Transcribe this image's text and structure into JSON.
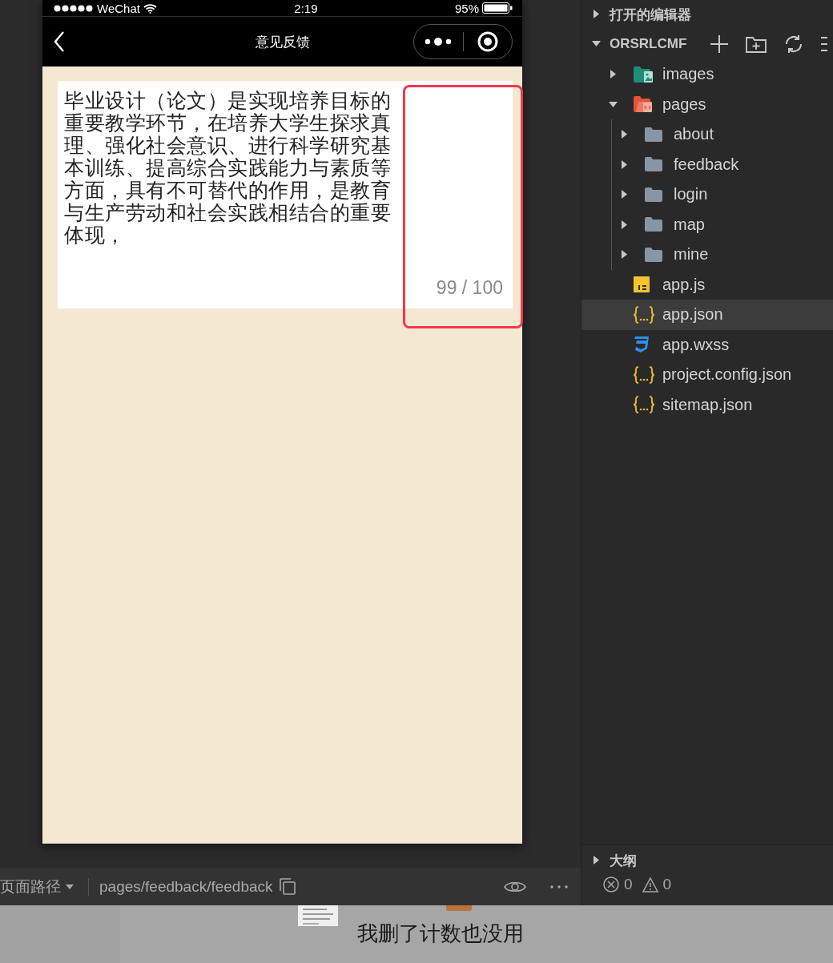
{
  "phone": {
    "status_bar": {
      "carrier": "WeChat",
      "time": "2:19",
      "battery": "95%"
    },
    "nav": {
      "title": "意见反馈"
    },
    "feedback_field": {
      "value": "毕业设计（论文）是实现培养目标的重要教学环节，在培养大学生探求真理、强化社会意识、进行科学研究基本训练、提高综合实践能力与素质等方面，具有不可替代的作用，是教育与生产劳动和社会实践相结合的重要体现，",
      "counter": "99 / 100"
    }
  },
  "explorer": {
    "open_editors": {
      "label": "打开的编辑器",
      "expanded": false
    },
    "project": {
      "label": "ORSRLCMF",
      "expanded": true
    },
    "tree": [
      {
        "name": "images",
        "kind": "images-folder",
        "expanded": false,
        "selected": false
      },
      {
        "name": "pages",
        "kind": "pages-folder",
        "expanded": true,
        "selected": false,
        "children": [
          {
            "name": "about",
            "kind": "folder",
            "expanded": false,
            "selected": false
          },
          {
            "name": "feedback",
            "kind": "folder",
            "expanded": false,
            "selected": false
          },
          {
            "name": "login",
            "kind": "folder",
            "expanded": false,
            "selected": false
          },
          {
            "name": "map",
            "kind": "folder",
            "expanded": false,
            "selected": false
          },
          {
            "name": "mine",
            "kind": "folder",
            "expanded": false,
            "selected": false
          }
        ]
      },
      {
        "name": "app.js",
        "kind": "js",
        "selected": false
      },
      {
        "name": "app.json",
        "kind": "json",
        "selected": true
      },
      {
        "name": "app.wxss",
        "kind": "css",
        "selected": false
      },
      {
        "name": "project.config.json",
        "kind": "json",
        "selected": false
      },
      {
        "name": "sitemap.json",
        "kind": "json",
        "selected": false
      }
    ],
    "outline": {
      "label": "大纲",
      "expanded": false
    },
    "problems": {
      "errors": "0",
      "warnings": "0"
    }
  },
  "path_bar": {
    "label": "页面路径",
    "path": "pages/feedback/feedback"
  },
  "caption": {
    "text": "我删了计数也没用"
  }
}
